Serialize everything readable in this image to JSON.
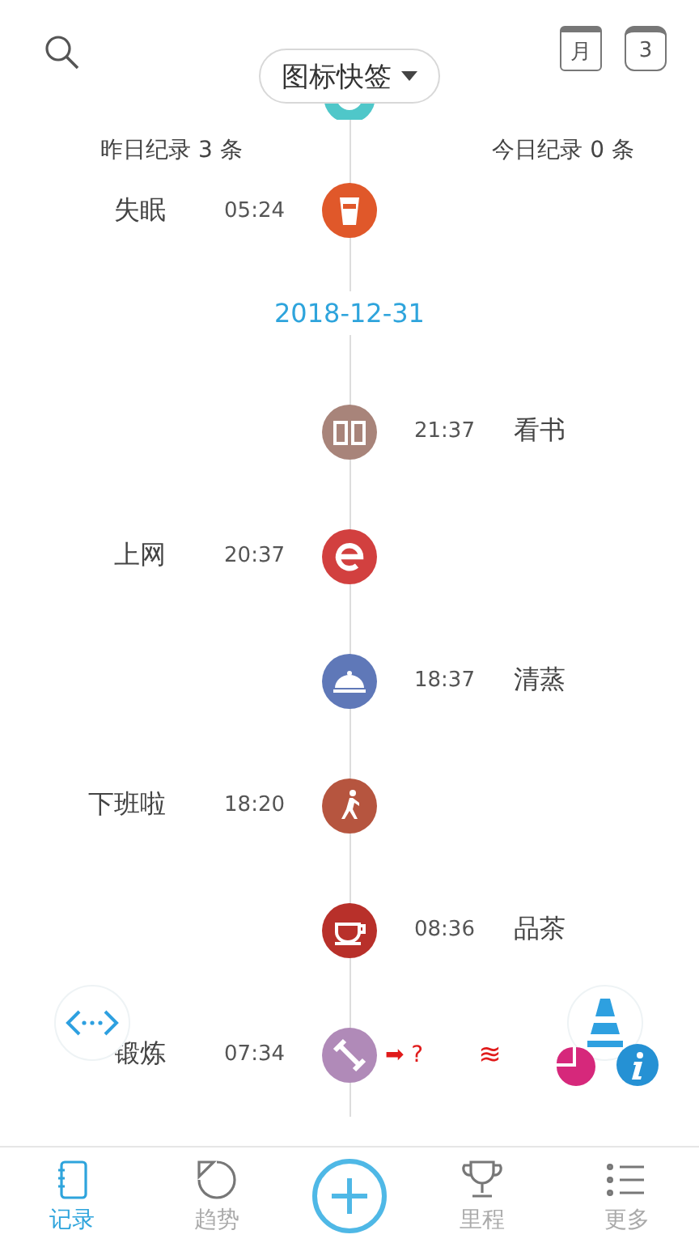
{
  "header": {
    "dropdown": "图标快签",
    "calendar_month": "月",
    "calendar_day": "3"
  },
  "summary": {
    "yesterday": "昨日纪录 3 条",
    "today": "今日纪录 0 条"
  },
  "timeline": [
    {
      "kind": "left-entry",
      "label": "失眠",
      "time": "05:24",
      "color": "#e0582a"
    },
    {
      "kind": "date",
      "label": "2018-12-31"
    },
    {
      "kind": "right-entry",
      "label": "看书",
      "time": "21:37",
      "color": "#a8847a"
    },
    {
      "kind": "left-entry",
      "label": "上网",
      "time": "20:37",
      "color": "#d2403f"
    },
    {
      "kind": "right-entry",
      "label": "清蒸",
      "time": "18:37",
      "color": "#5f78b8"
    },
    {
      "kind": "left-entry",
      "label": "下班啦",
      "time": "18:20",
      "color": "#b6553f"
    },
    {
      "kind": "right-entry",
      "label": "品茶",
      "time": "08:36",
      "color": "#b8302a"
    },
    {
      "kind": "left-entry",
      "label": "锻炼",
      "time": "07:34",
      "color": "#b08ab8",
      "extras": [
        "➡ ?",
        "≋"
      ]
    }
  ],
  "nav": [
    {
      "label": "记录",
      "selected": true
    },
    {
      "label": "趋势",
      "selected": false
    },
    {
      "kind": "add"
    },
    {
      "label": "里程",
      "selected": false
    },
    {
      "label": "更多",
      "selected": false
    }
  ]
}
